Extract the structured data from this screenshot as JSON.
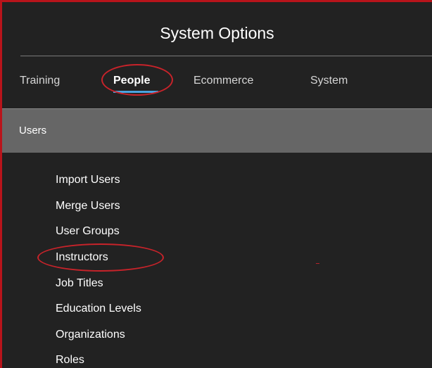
{
  "header": {
    "title": "System Options"
  },
  "tabs": [
    {
      "label": "Training",
      "active": false
    },
    {
      "label": "People",
      "active": true
    },
    {
      "label": "Ecommerce",
      "active": false
    },
    {
      "label": "System",
      "active": false
    }
  ],
  "section": {
    "title": "Users"
  },
  "menu": {
    "items": [
      {
        "label": "Import Users"
      },
      {
        "label": "Merge Users"
      },
      {
        "label": "User Groups"
      },
      {
        "label": "Instructors"
      },
      {
        "label": "Job Titles"
      },
      {
        "label": "Education Levels"
      },
      {
        "label": "Organizations"
      },
      {
        "label": "Roles"
      }
    ]
  },
  "annotations": {
    "highlight_color": "#c8232a",
    "active_tab_underline_color": "#4aa3df",
    "frame_border_color": "#b8141b"
  }
}
